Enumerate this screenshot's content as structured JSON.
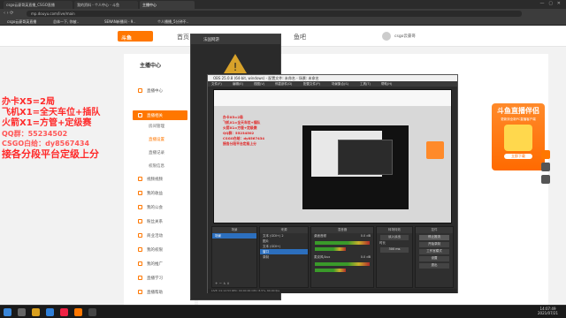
{
  "browser": {
    "tabs": [
      {
        "label": "csgo云豪哥英直播_CSGO直播"
      },
      {
        "label": "我的资料 - 个人中心 - 斗鱼"
      },
      {
        "label": "主播中心"
      }
    ],
    "url": "mp.douyu.com/live/main",
    "bookmarks": [
      "csgo云豪哥英直播",
      "总体一下, 你被..",
      "SENAN新播间 - 9..",
      "个人播播_5分钟不.."
    ]
  },
  "site": {
    "logo": "斗鱼",
    "nav": [
      "首页",
      "鱼吧"
    ],
    "user": "csgo云豪哥"
  },
  "sidebar": {
    "title": "主播中心",
    "items": [
      {
        "label": "直播中心",
        "icon": "home-icon"
      },
      {
        "label": "直播相关",
        "icon": "live-icon"
      },
      {
        "label": "视频视频",
        "icon": "video-icon"
      },
      {
        "label": "我的收益",
        "icon": "wallet-icon"
      },
      {
        "label": "我的公会",
        "icon": "group-icon"
      },
      {
        "label": "粉丝关系",
        "icon": "fans-icon"
      },
      {
        "label": "商业活动",
        "icon": "activity-icon"
      },
      {
        "label": "我的权限",
        "icon": "permission-icon"
      },
      {
        "label": "我的推广",
        "icon": "promote-icon"
      },
      {
        "label": "直播学习",
        "icon": "study-icon"
      },
      {
        "label": "直播帮助",
        "icon": "help-icon"
      }
    ],
    "subitems": [
      "房间管理",
      "直播设置",
      "直播记录",
      "权限信息"
    ]
  },
  "overlay_text": {
    "line1": "办卡X5=2局",
    "line2": "飞机X1=全天车位+插队",
    "line3": "火箭X1=方管+定级赛",
    "line4": "QQ群：55234502",
    "line5": "CSGO白给：dy8567434",
    "line6": "接各分段平台定级上分"
  },
  "promo": {
    "title": "斗鱼直播伴侣",
    "subtitle": "更新到全新PC直播客户端",
    "button": "立即下载"
  },
  "obs": {
    "small_title": "法国网游",
    "title": "OBS 25.0.8 (64-bit, windows) - 配置文件: 未命名 - 场景: 未命名",
    "menus": [
      "文件(F)",
      "编辑(E)",
      "视图(V)",
      "停靠部件(D)",
      "配置文件(P)",
      "场景集合(S)",
      "工具(T)",
      "帮助(H)"
    ],
    "docks": {
      "scenes_label": "场景",
      "sources_label": "来源",
      "mixer_label": "混音器",
      "transitions_label": "转场特效",
      "controls_label": "控件"
    },
    "scenes": [
      "场景"
    ],
    "sources": [
      "文本 (GDI+) 2",
      "图片",
      "文本 (GDI+)",
      "窗口",
      "录制"
    ],
    "mixer": [
      {
        "name": "桌面音频",
        "level": "0.0 dB"
      },
      {
        "name": "麦克风/Aux",
        "level": "0.0 dB"
      }
    ],
    "transition": {
      "type": "淡入淡出",
      "duration_label": "时长",
      "duration": "300 ms"
    },
    "controls": [
      "停止推流",
      "开始录制",
      "工作室模式",
      "设置",
      "退出"
    ],
    "status": "LIVE: 01:12:53   REC: 00:00:00   CPU: 8.5%, 60.00 fps"
  },
  "taskbar": {
    "time": "14:07:49",
    "date": "2021/07/21"
  },
  "colors": {
    "brand_orange": "#ff7700",
    "overlay_red": "#ff2a2a",
    "obs_bg": "#2b2b2b",
    "obs_select": "#2c6fbe"
  }
}
